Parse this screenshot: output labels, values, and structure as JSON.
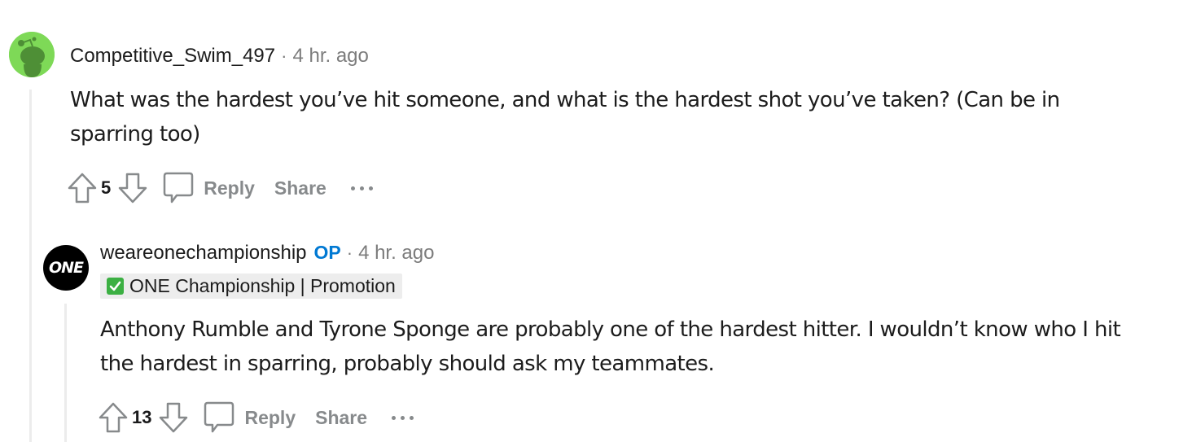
{
  "comments": [
    {
      "username": "Competitive_Swim_497",
      "separator": "·",
      "time": "4 hr. ago",
      "avatar": "snoo-avatar-icon",
      "avatar_color": "#7ed957",
      "body": "What was the hardest you’ve hit someone, and what is the hardest shot you’ve taken? (Can be in sparring too)",
      "score": "5",
      "actions": {
        "reply": "Reply",
        "share": "Share",
        "more": "more-options-icon"
      }
    },
    {
      "username": "weareonechampionship",
      "op_badge": "OP",
      "separator": "·",
      "time": "4 hr. ago",
      "avatar_text": "ONE",
      "flair": "ONE Championship | Promotion",
      "flair_icon": "check-mark-emoji-icon",
      "body": "Anthony Rumble and Tyrone Sponge are probably one of the hardest hitter. I wouldn’t know who I hit the hardest in sparring, probably should ask my teammates.",
      "score": "13",
      "actions": {
        "reply": "Reply",
        "share": "Share",
        "more": "more-options-icon"
      }
    }
  ],
  "colors": {
    "op": "#0079d3",
    "action": "#878a8c",
    "meta": "#7c7c7c",
    "thread_line": "#ececec"
  }
}
